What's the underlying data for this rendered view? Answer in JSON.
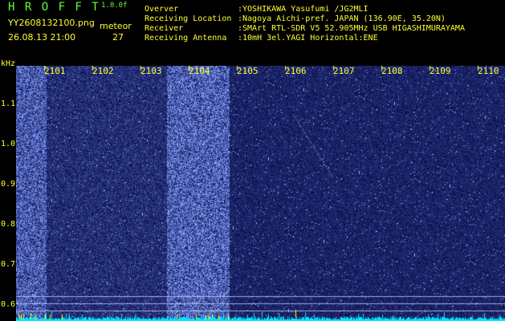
{
  "header": {
    "app_name": "H R O F F T",
    "version": "1.0.0f",
    "filename": "YY2608132100.png",
    "datetime": "26.08.13 21:00",
    "meteor_label": "meteor",
    "meteor_count": "27",
    "info_labels": [
      "Overver",
      "Receiving Location",
      "Receiver",
      "Receiving Antenna"
    ],
    "info_values": [
      ":YOSHIKAWA Yasufumi /JG2MLI",
      ":Nagoya Aichi-pref. JAPAN (136.90E, 35.20N)",
      ":SMArt RTL-SDR V5 52.905MHz USB HIGASHIMURAYAMA",
      ":10mH 3el.YAGI Horizontal:ENE"
    ]
  },
  "axis": {
    "unit": "kHz",
    "y_ticks": [
      "1.1",
      "1.0",
      "0.9",
      "0.8",
      "0.7",
      "0.6"
    ],
    "time_ticks": [
      "2101",
      "2102",
      "2103",
      "2104",
      "2105",
      "2106",
      "2107",
      "2108",
      "2109",
      "2110"
    ]
  },
  "colors": {
    "background": "#000000",
    "noise_dark": "#06065a",
    "noise_light": "#c8c8ff",
    "bright_band": "#7a9dff",
    "baseline": "#00e5ff",
    "marker": "#ffff00"
  }
}
